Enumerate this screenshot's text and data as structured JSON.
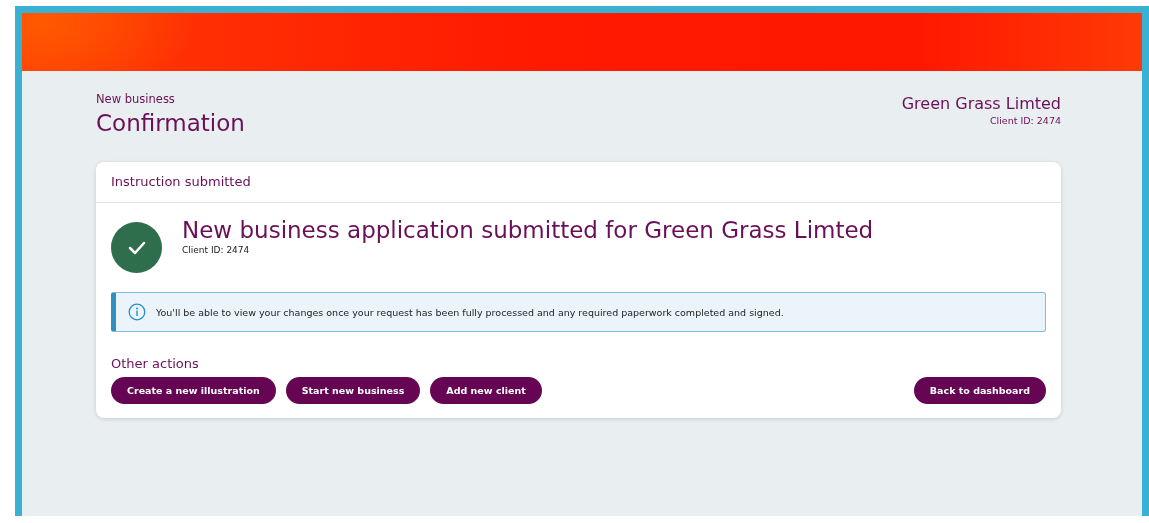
{
  "breadcrumb": "New business",
  "page_title": "Confirmation",
  "client": {
    "name": "Green Grass Limted",
    "id_label": "Client ID: 2474"
  },
  "card": {
    "header": "Instruction submitted",
    "status": {
      "kind": "success",
      "title": "New business application submitted for Green Grass Limted",
      "subtitle": "Client ID: 2474"
    },
    "notice": {
      "kind": "info",
      "text": "You'll be able to view your changes once your request has been fully processed and any required paperwork completed and signed."
    },
    "other_actions": {
      "label": "Other actions",
      "buttons": [
        "Create a new illustration",
        "Start new business",
        "Add new client"
      ]
    },
    "back_button": "Back to dashboard"
  }
}
